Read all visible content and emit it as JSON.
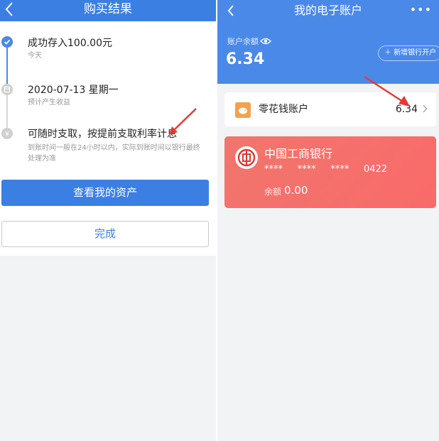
{
  "left": {
    "header": {
      "title": "购买结果"
    },
    "steps": [
      {
        "title": "成功存入100.00元",
        "subtitle": "今天"
      },
      {
        "title": "2020-07-13 星期一",
        "subtitle": "预计产生收益"
      },
      {
        "title": "可随时支取，按提前支取利率计息",
        "subtitle": "到账时间一般在24小时以内，实际到账时间以银行最终处理为准"
      }
    ],
    "buttons": {
      "view_assets": "查看我的资产",
      "done": "完成"
    }
  },
  "right": {
    "header": {
      "title": "我的电子账户",
      "more": "•••"
    },
    "balance": {
      "label": "账户余额",
      "value": "6.34"
    },
    "add_bank": {
      "label": "新增银行开户"
    },
    "linghuaqian": {
      "name": "零花钱账户",
      "value": "6.34"
    },
    "bank_card": {
      "name": "中国工商银行",
      "number": "****     ****     ****     0422",
      "balance_label": "余额",
      "balance_value": "0.00"
    }
  },
  "colors": {
    "primary": "#3b7fe3",
    "header_blue": "#4a89e8",
    "card_red": "#f86b6b",
    "annotation": "#e53935"
  }
}
